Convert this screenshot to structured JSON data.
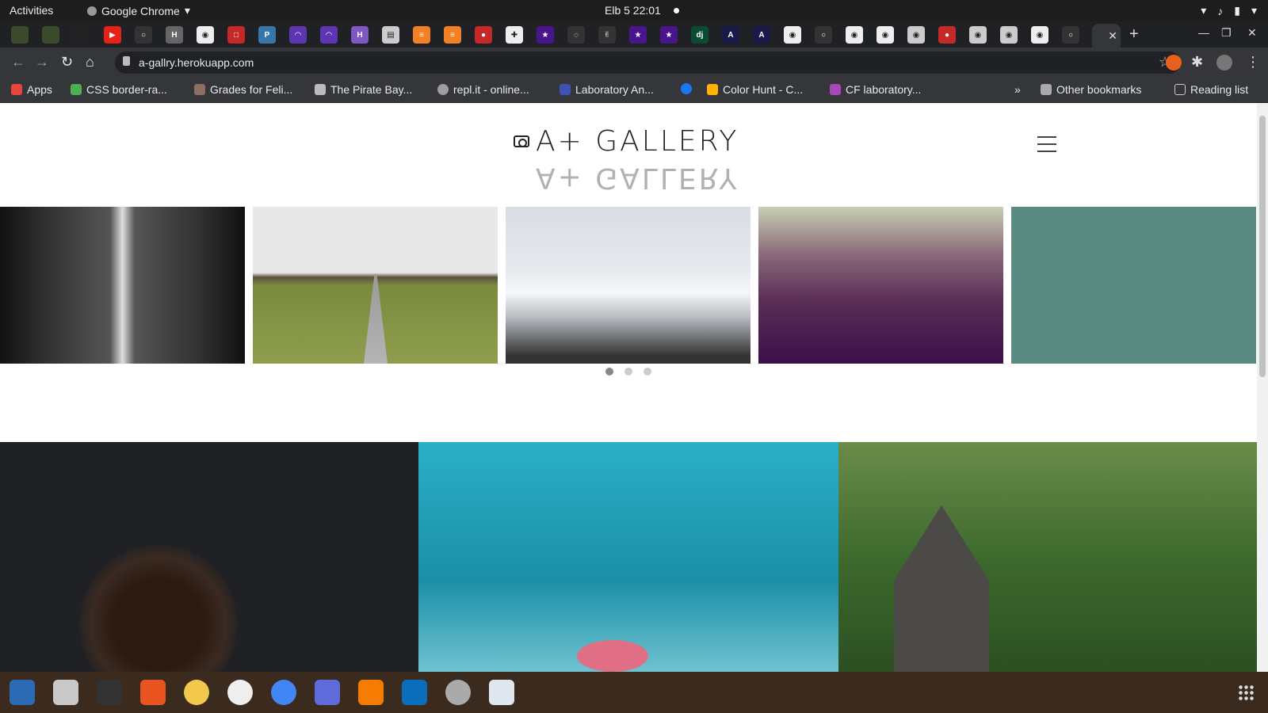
{
  "topbar": {
    "activities": "Activities",
    "app_name": "Google Chrome",
    "clock": "Elb 5  22:01"
  },
  "tabs": {
    "active_close": "✕",
    "new_tab": "+"
  },
  "toolbar": {
    "url": "a-gallry.herokuapp.com"
  },
  "bookmarks": [
    {
      "label": "Apps",
      "color": "#e8453c"
    },
    {
      "label": "CSS border-ra...",
      "color": "#4caf50"
    },
    {
      "label": "Grades for Feli...",
      "color": "#8d6e63"
    },
    {
      "label": "The Pirate Bay...",
      "color": "#bbbbbb"
    },
    {
      "label": "repl.it - online...",
      "color": "#9e9e9e"
    },
    {
      "label": "Laboratory An...",
      "color": "#3f51b5"
    },
    {
      "label": "",
      "color": "#1877f2"
    },
    {
      "label": "Color Hunt - C...",
      "color": "#ffb300"
    },
    {
      "label": "CF laboratory...",
      "color": "#ab47bc"
    }
  ],
  "bookmarks_more": "»",
  "other_bookmarks": "Other bookmarks",
  "reading_list": "Reading list",
  "site": {
    "logo_text": "A+ GALLERY",
    "slider_dots": 3,
    "active_dot": 1
  }
}
